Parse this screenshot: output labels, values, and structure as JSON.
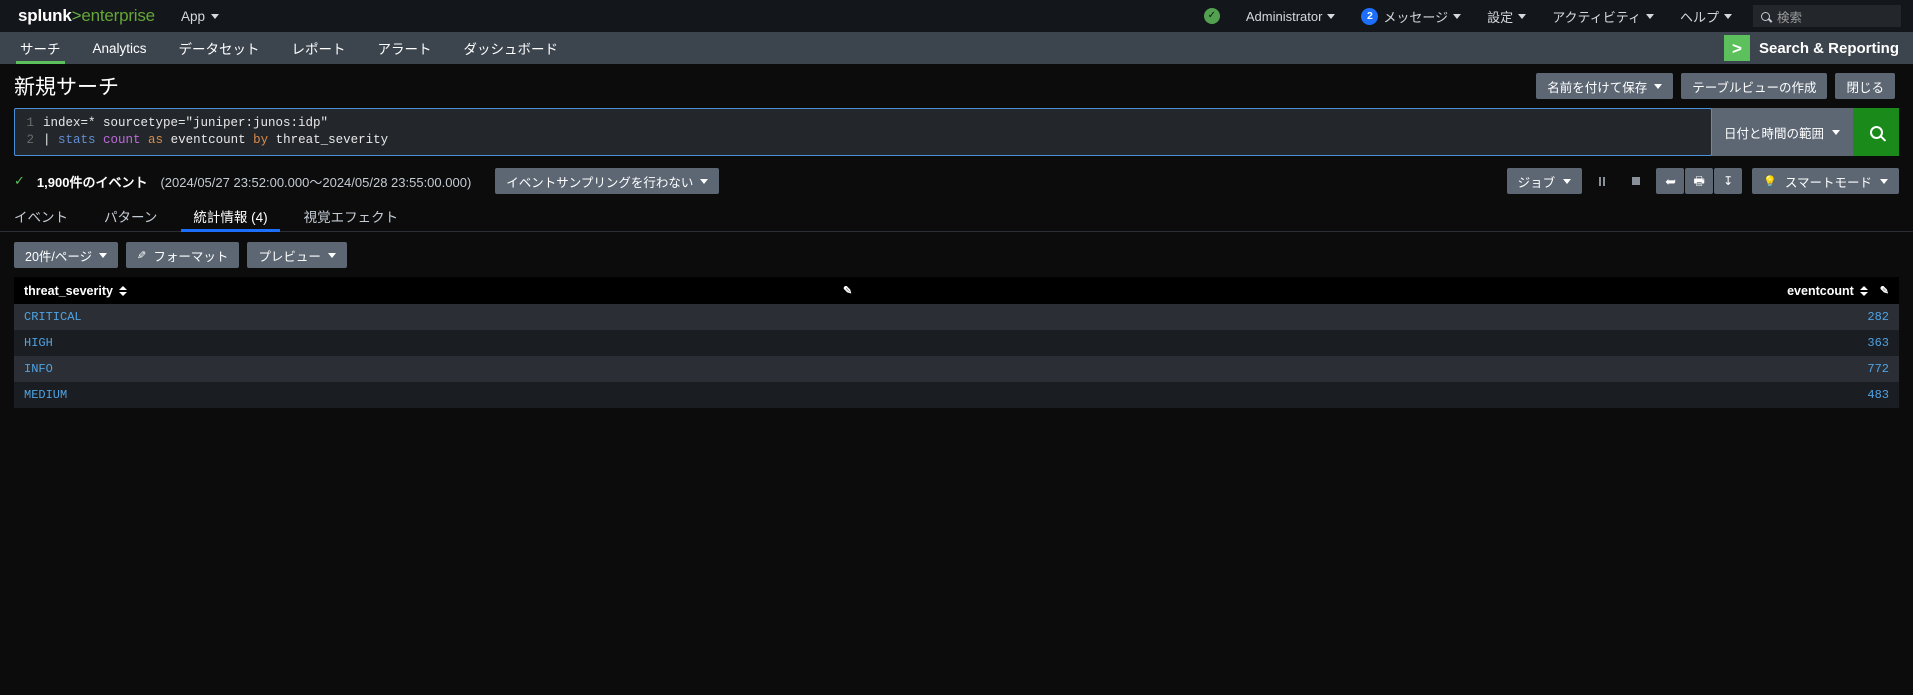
{
  "topbar": {
    "logo_main": "splunk",
    "logo_gt": ">",
    "logo_sub": "enterprise",
    "app_menu": "App",
    "health_icon": "health-check-icon",
    "user": "Administrator",
    "messages_count": "2",
    "messages": "メッセージ",
    "settings": "設定",
    "activity": "アクティビティ",
    "help": "ヘルプ",
    "search_placeholder": "検索"
  },
  "nav": {
    "items": [
      {
        "label": "サーチ",
        "active": true
      },
      {
        "label": "Analytics",
        "active": false
      },
      {
        "label": "データセット",
        "active": false
      },
      {
        "label": "レポート",
        "active": false
      },
      {
        "label": "アラート",
        "active": false
      },
      {
        "label": "ダッシュボード",
        "active": false
      }
    ],
    "app_icon_glyph": ">",
    "app_name": "Search & Reporting"
  },
  "page": {
    "title": "新規サーチ",
    "save_as": "名前を付けて保存",
    "create_table_view": "テーブルビューの作成",
    "close": "閉じる"
  },
  "query": {
    "line1_num": "1",
    "line2_num": "2",
    "line1_text": "index=* sourcetype=\"juniper:junos:idp\"",
    "line2_pipe": "| ",
    "line2_cmd": "stats ",
    "line2_fn": "count ",
    "line2_as": "as ",
    "line2_field": "eventcount ",
    "line2_by": "by ",
    "line2_groupfield": "threat_severity",
    "time_range_label": "日付と時間の範囲",
    "search_button_icon": "magnifier-icon"
  },
  "results": {
    "event_count": "1,900件のイベント",
    "time_range": "(2024/05/27 23:52:00.000〜2024/05/28 23:55:00.000)",
    "sampling_label": "イベントサンプリングを行わない",
    "job_label": "ジョブ",
    "pause_icon": "pause-icon",
    "stop_icon": "stop-icon",
    "share_icon": "share-icon",
    "print_icon": "print-icon",
    "export_icon": "download-icon",
    "smart_mode": "スマートモード"
  },
  "tabs": [
    {
      "label": "イベント",
      "active": false
    },
    {
      "label": "パターン",
      "active": false
    },
    {
      "label": "統計情報 (4)",
      "active": true
    },
    {
      "label": "視覚エフェクト",
      "active": false
    }
  ],
  "format_toolbar": {
    "per_page": "20件/ページ",
    "format": "フォーマット",
    "preview": "プレビュー"
  },
  "table": {
    "columns": [
      {
        "label": "threat_severity",
        "align": "left"
      },
      {
        "label": "eventcount",
        "align": "right"
      }
    ],
    "rows": [
      {
        "threat_severity": "CRITICAL",
        "eventcount": "282"
      },
      {
        "threat_severity": "HIGH",
        "eventcount": "363"
      },
      {
        "threat_severity": "INFO",
        "eventcount": "772"
      },
      {
        "threat_severity": "MEDIUM",
        "eventcount": "483"
      }
    ]
  },
  "colors": {
    "accent_green": "#65a637",
    "link_blue": "#4fa3e3",
    "tab_active": "#1c6efb",
    "nav_bg": "#3c444d",
    "button_bg": "#5c6773"
  }
}
